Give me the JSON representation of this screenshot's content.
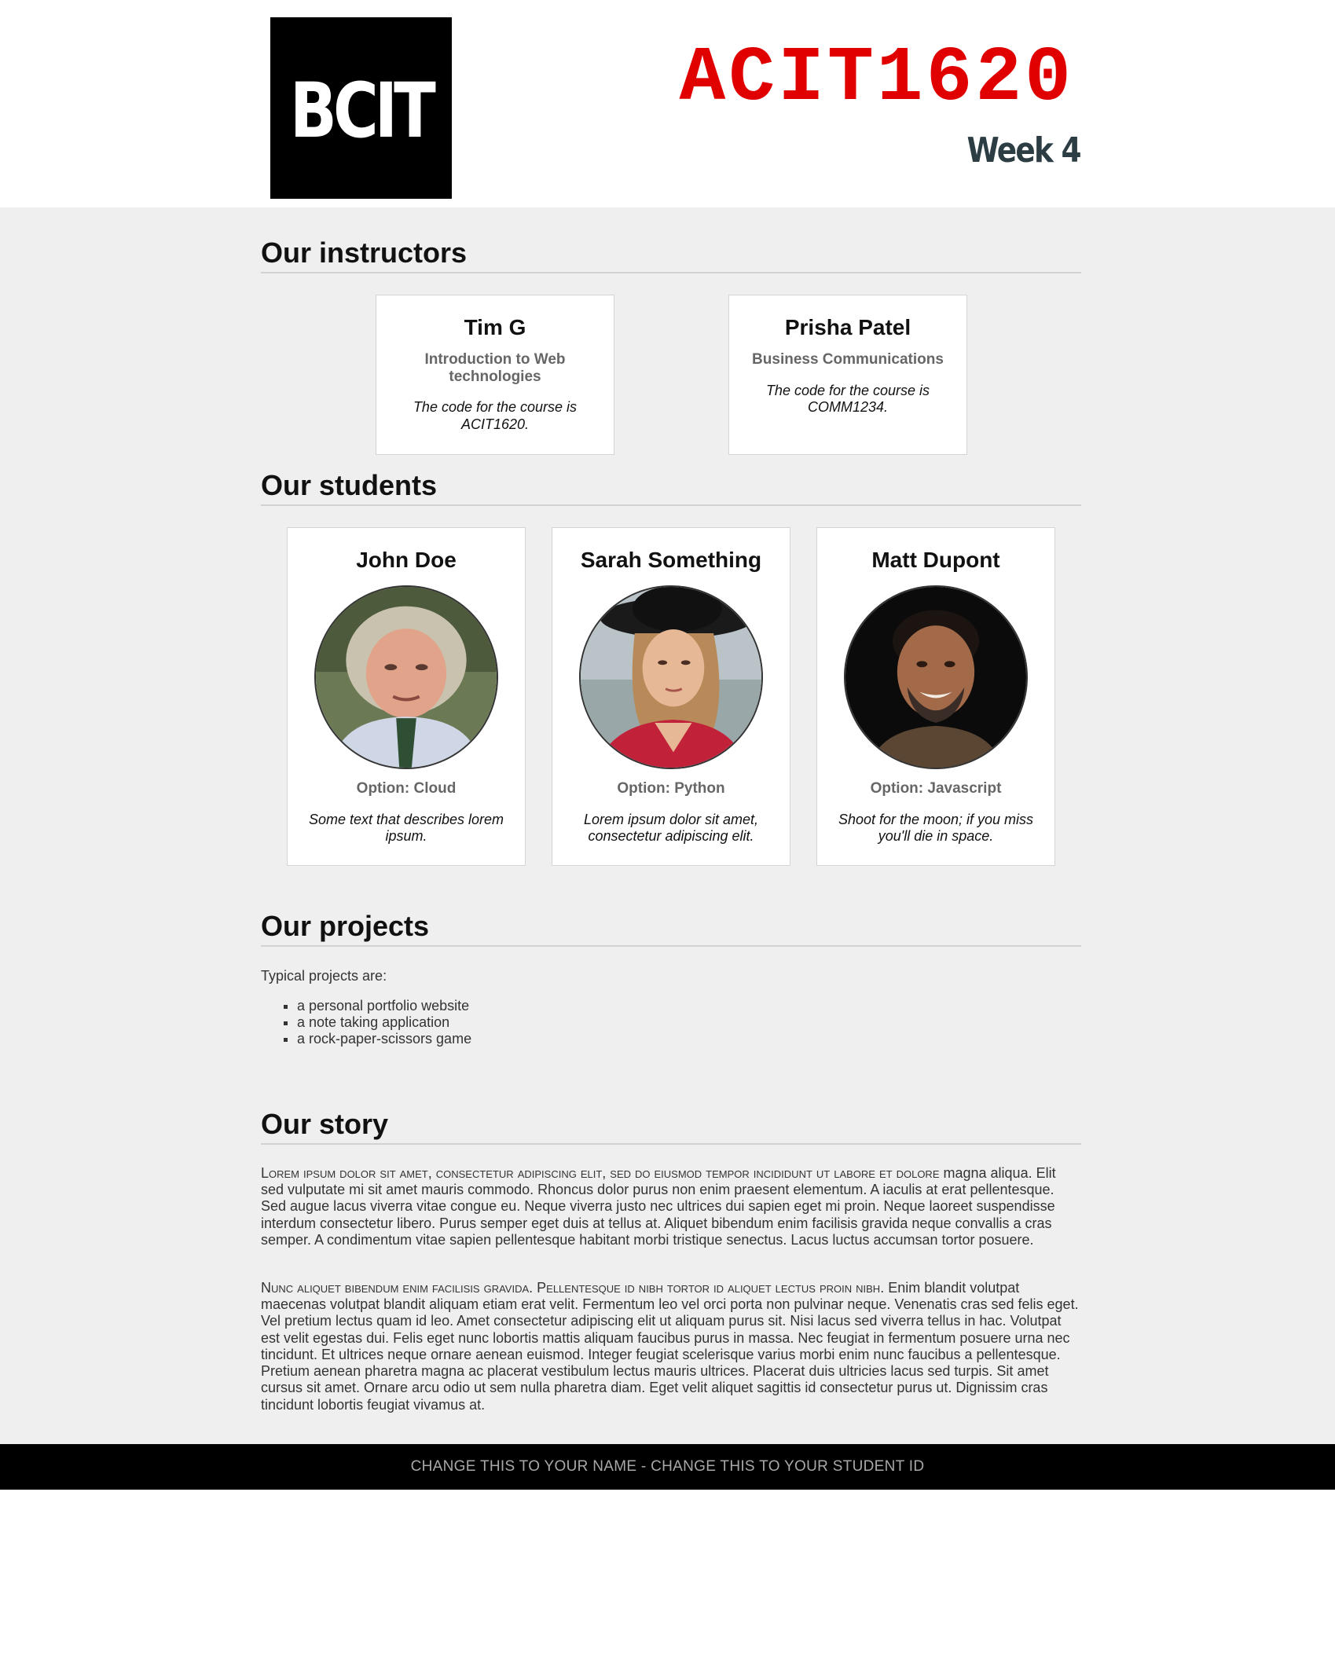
{
  "header": {
    "logo_text": "BCIT",
    "course_code": "ACIT1620",
    "week": "Week 4"
  },
  "instructors": {
    "title": "Our instructors",
    "items": [
      {
        "name": "Tim G",
        "course": "Introduction to Web technologies",
        "description": "The code for the course is ACIT1620."
      },
      {
        "name": "Prisha Patel",
        "course": "Business Communications",
        "description": "The code for the course is COMM1234."
      }
    ]
  },
  "students": {
    "title": "Our students",
    "items": [
      {
        "name": "John Doe",
        "option": "Option: Cloud",
        "description": "Some text that describes lorem ipsum."
      },
      {
        "name": "Sarah Something",
        "option": "Option: Python",
        "description": "Lorem ipsum dolor sit amet, consectetur adipiscing elit."
      },
      {
        "name": "Matt Dupont",
        "option": "Option: Javascript",
        "description": "Shoot for the moon; if you miss you'll die in space."
      }
    ]
  },
  "projects": {
    "title": "Our projects",
    "intro": "Typical projects are:",
    "items": [
      "a personal portfolio website",
      "a note taking application",
      "a rock-paper-scissors game"
    ]
  },
  "story": {
    "title": "Our story",
    "paragraphs": [
      {
        "lead": "Lorem ipsum dolor sit amet, consectetur adipiscing elit, sed do eiusmod tempor incididunt ut labore et dolore",
        "body": " magna aliqua. Elit sed vulputate mi sit amet mauris commodo. Rhoncus dolor purus non enim praesent elementum. A iaculis at erat pellentesque. Sed augue lacus viverra vitae congue eu. Neque viverra justo nec ultrices dui sapien eget mi proin. Neque laoreet suspendisse interdum consectetur libero. Purus semper eget duis at tellus at. Aliquet bibendum enim facilisis gravida neque convallis a cras semper. A condimentum vitae sapien pellentesque habitant morbi tristique senectus. Lacus luctus accumsan tortor posuere."
      },
      {
        "lead": "Nunc aliquet bibendum enim facilisis gravida. Pellentesque id nibh tortor id aliquet lectus proin nibh.",
        "body": " Enim blandit volutpat maecenas volutpat blandit aliquam etiam erat velit. Fermentum leo vel orci porta non pulvinar neque. Venenatis cras sed felis eget. Vel pretium lectus quam id leo. Amet consectetur adipiscing elit ut aliquam purus sit. Nisi lacus sed viverra tellus in hac. Volutpat est velit egestas dui. Felis eget nunc lobortis mattis aliquam faucibus purus in massa. Nec feugiat in fermentum posuere urna nec tincidunt. Et ultrices neque ornare aenean euismod. Integer feugiat scelerisque varius morbi enim nunc faucibus a pellentesque. Pretium aenean pharetra magna ac placerat vestibulum lectus mauris ultrices. Placerat duis ultricies lacus sed turpis. Sit amet cursus sit amet. Ornare arcu odio ut sem nulla pharetra diam. Eget velit aliquet sagittis id consectetur purus ut. Dignissim cras tincidunt lobortis feugiat vivamus at."
      }
    ]
  },
  "footer": {
    "text": "CHANGE THIS TO YOUR NAME - CHANGE THIS TO YOUR STUDENT ID"
  },
  "colors": {
    "course_code": "#e00000",
    "week": "#2c3e44",
    "main_background": "#efefef",
    "footer_background": "#000000"
  }
}
